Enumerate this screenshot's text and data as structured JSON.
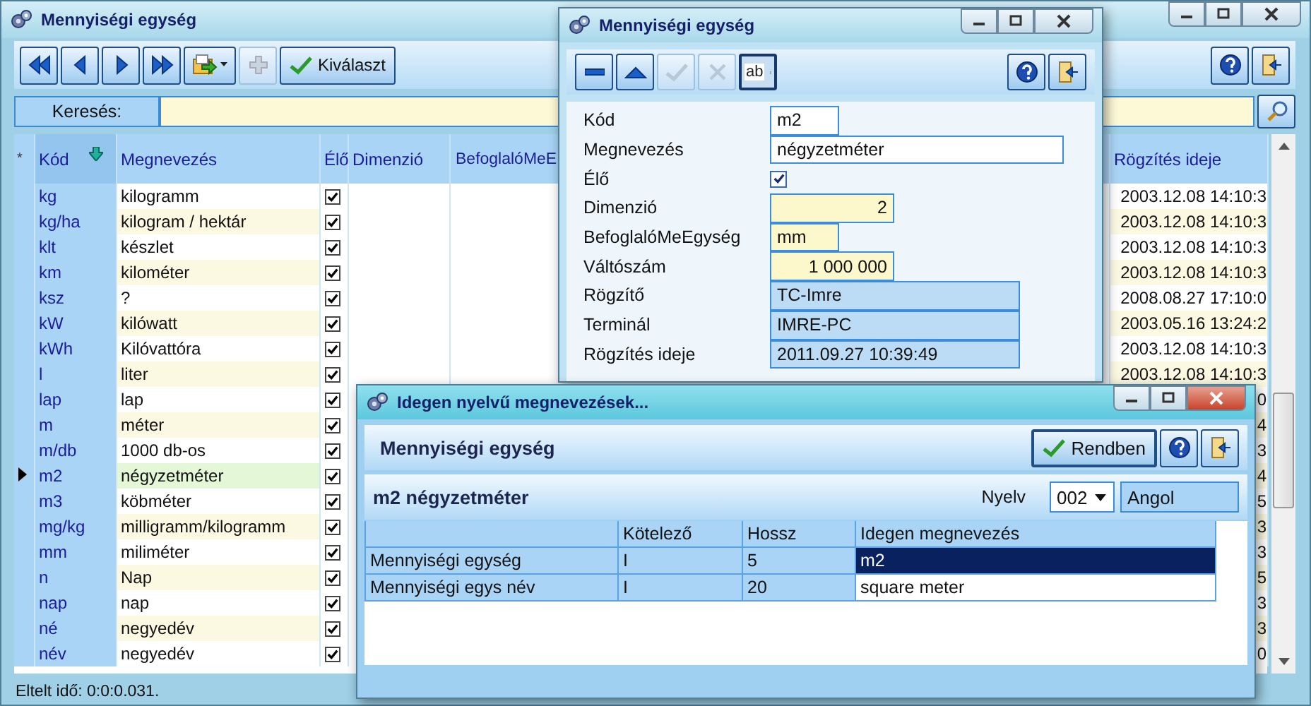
{
  "main_window": {
    "title": "Mennyiségi egység",
    "active": false,
    "toolbar": [
      {
        "kind": "first",
        "disabled": false
      },
      {
        "kind": "prev",
        "disabled": false
      },
      {
        "kind": "next",
        "disabled": false
      },
      {
        "kind": "last",
        "disabled": false
      },
      {
        "kind": "export",
        "disabled": false
      },
      {
        "kind": "add",
        "disabled": true
      },
      {
        "kind": "select",
        "label": "Kiválaszt",
        "disabled": false
      },
      {
        "kind": "help",
        "disabled": false
      },
      {
        "kind": "exit",
        "disabled": false
      }
    ],
    "search": {
      "label": "Keresés:"
    },
    "table": {
      "columns": [
        {
          "label": "*",
          "sorted": false
        },
        {
          "label": "Kód",
          "sorted": true
        },
        {
          "label": "Megnevezés",
          "sorted": false
        },
        {
          "label": "Élő",
          "sorted": false
        },
        {
          "label": "Dimenzió",
          "sorted": false
        },
        {
          "label": "BefoglalóMeE",
          "sorted": false
        },
        {
          "label": "Rögzítés ideje",
          "sorted": false
        }
      ],
      "rows": [
        {
          "code": "kg",
          "name": "kilogramm",
          "live": true,
          "date": "2003.12.08 14:10:3",
          "selected": false
        },
        {
          "code": "kg/ha",
          "name": "kilogram / hektár",
          "live": true,
          "date": "2003.12.08 14:10:3",
          "selected": false
        },
        {
          "code": "klt",
          "name": "készlet",
          "live": true,
          "date": "2003.12.08 14:10:3",
          "selected": false
        },
        {
          "code": "km",
          "name": "kilométer",
          "live": true,
          "date": "2003.12.08 14:10:3",
          "selected": false
        },
        {
          "code": "ksz",
          "name": "?",
          "live": true,
          "date": "2008.08.27 17:10:0",
          "selected": false
        },
        {
          "code": "kW",
          "name": "kilówatt",
          "live": true,
          "date": "2003.05.16 13:24:2",
          "selected": false
        },
        {
          "code": "kWh",
          "name": "Kilóvattóra",
          "live": true,
          "date": "2003.12.08 14:10:3",
          "selected": false
        },
        {
          "code": "l",
          "name": "liter",
          "live": true,
          "date": "2003.12.08 14:10:3",
          "selected": false
        },
        {
          "code": "lap",
          "name": "lap",
          "live": true,
          "date": "0",
          "selected": false
        },
        {
          "code": "m",
          "name": "méter",
          "live": true,
          "date": "4",
          "selected": false
        },
        {
          "code": "m/db",
          "name": "1000 db-os",
          "live": true,
          "date": "3",
          "selected": false
        },
        {
          "code": "m2",
          "name": "négyzetméter",
          "live": true,
          "date": "4",
          "selected": true
        },
        {
          "code": "m3",
          "name": "köbméter",
          "live": true,
          "date": "5",
          "selected": false
        },
        {
          "code": "mg/kg",
          "name": "milligramm/kilogramm",
          "live": true,
          "date": "3",
          "selected": false
        },
        {
          "code": "mm",
          "name": "miliméter",
          "live": true,
          "date": "3",
          "selected": false
        },
        {
          "code": "n",
          "name": "Nap",
          "live": true,
          "date": "5",
          "selected": false
        },
        {
          "code": "nap",
          "name": "nap",
          "live": true,
          "date": "3",
          "selected": false
        },
        {
          "code": "né",
          "name": "negyedév",
          "live": true,
          "date": "3",
          "selected": false
        },
        {
          "code": "név",
          "name": "negyedév",
          "live": true,
          "date": "0",
          "selected": false
        }
      ]
    },
    "status_bar": "Eltelt idő: 0:0:0.031."
  },
  "edit_dialog": {
    "title": "Mennyiségi egység",
    "active": false,
    "toolbar": [
      {
        "kind": "delete",
        "disabled": false
      },
      {
        "kind": "up",
        "disabled": false
      },
      {
        "kind": "save",
        "disabled": true
      },
      {
        "kind": "cancel",
        "disabled": true
      },
      {
        "kind": "text",
        "label": "ab",
        "disabled": false
      },
      {
        "kind": "help",
        "disabled": false
      },
      {
        "kind": "exit",
        "disabled": false
      }
    ],
    "fields": [
      {
        "label": "Kód",
        "kind": "text",
        "value": "m2"
      },
      {
        "label": "Megnevezés",
        "kind": "text",
        "value": "négyzetméter"
      },
      {
        "label": "Élő",
        "kind": "checkbox",
        "checked": true
      },
      {
        "label": "Dimenzió",
        "kind": "number",
        "value": "2"
      },
      {
        "label": "BefoglalóMeEgység",
        "kind": "lookup",
        "value": "mm"
      },
      {
        "label": "Váltószám",
        "kind": "number",
        "value": "1 000 000"
      },
      {
        "label": "Rögzítő",
        "kind": "readonly",
        "value": "TC-Imre"
      },
      {
        "label": "Terminál",
        "kind": "readonly",
        "value": "IMRE-PC"
      },
      {
        "label": "Rögzítés ideje",
        "kind": "readonly",
        "value": "2011.09.27 10:39:49"
      }
    ]
  },
  "foreign_dialog": {
    "title": "Idegen nyelvű megnevezések...",
    "active": true,
    "heading": "Mennyiségi egység",
    "buttons": [
      {
        "kind": "ok",
        "label": "Rendben"
      },
      {
        "kind": "help"
      },
      {
        "kind": "exit"
      }
    ],
    "subheading": "m2 négyzetméter",
    "language": {
      "label": "Nyelv",
      "code": "002",
      "name": "Angol"
    },
    "table": {
      "columns": [
        "Kötelező",
        "Hossz",
        "Idegen megnevezés"
      ],
      "rows": [
        {
          "field": "Mennyiségi egység",
          "required": "I",
          "length": "5",
          "foreign": "m2",
          "selected": true
        },
        {
          "field": "Mennyiségi egys név",
          "required": "I",
          "length": "20",
          "foreign": "square meter",
          "selected": false
        }
      ]
    }
  }
}
